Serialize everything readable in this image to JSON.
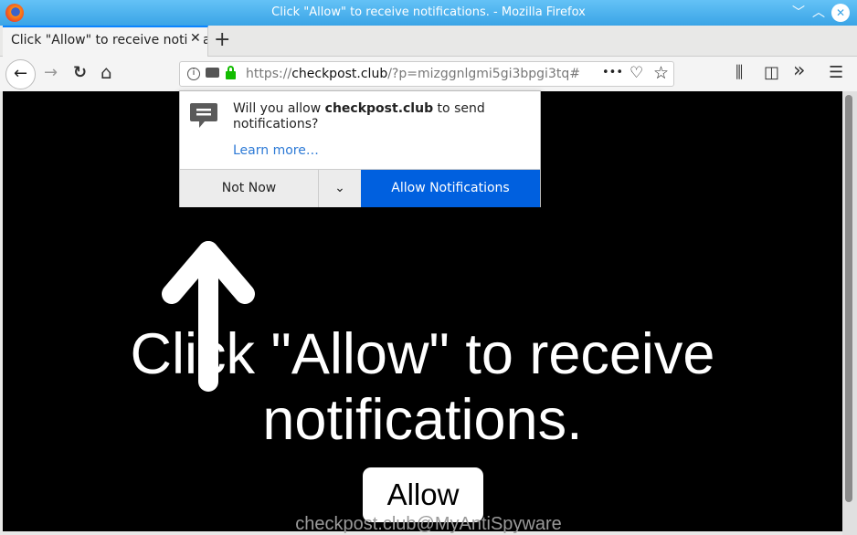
{
  "window": {
    "title": "Click \"Allow\" to receive notifications. - Mozilla Firefox",
    "min": "﹀",
    "max": "︿",
    "close": "✕"
  },
  "tab": {
    "title": "Click \"Allow\" to receive notifications.",
    "close": "✕",
    "new": "+"
  },
  "nav": {
    "back": "←",
    "forward": "→",
    "reload": "↻",
    "home": "⌂"
  },
  "url": {
    "scheme": "https://",
    "host": "checkpost.club",
    "path": "/?p=mizggnlgmi5gi3bpgi3tq#",
    "more": "•••",
    "pocket": "♡",
    "star": "☆"
  },
  "toolbar": {
    "library": "⫼",
    "sidebar": "◫",
    "overflow": "»",
    "menu": "☰"
  },
  "popup": {
    "pre": "Will you allow ",
    "site": "checkpost.club",
    "post": " to send notifications?",
    "learn": "Learn more…",
    "not_now": "Not Now",
    "dropdown": "⌄",
    "allow": "Allow Notifications"
  },
  "page": {
    "line1": "Click \"Allow\" to receive",
    "line2": "notifications.",
    "allow_button": "Allow",
    "watermark": "checkpost.club@MyAntiSpyware"
  },
  "colors": {
    "accent": "#0060df",
    "titlebar": "#3aa4e6"
  }
}
